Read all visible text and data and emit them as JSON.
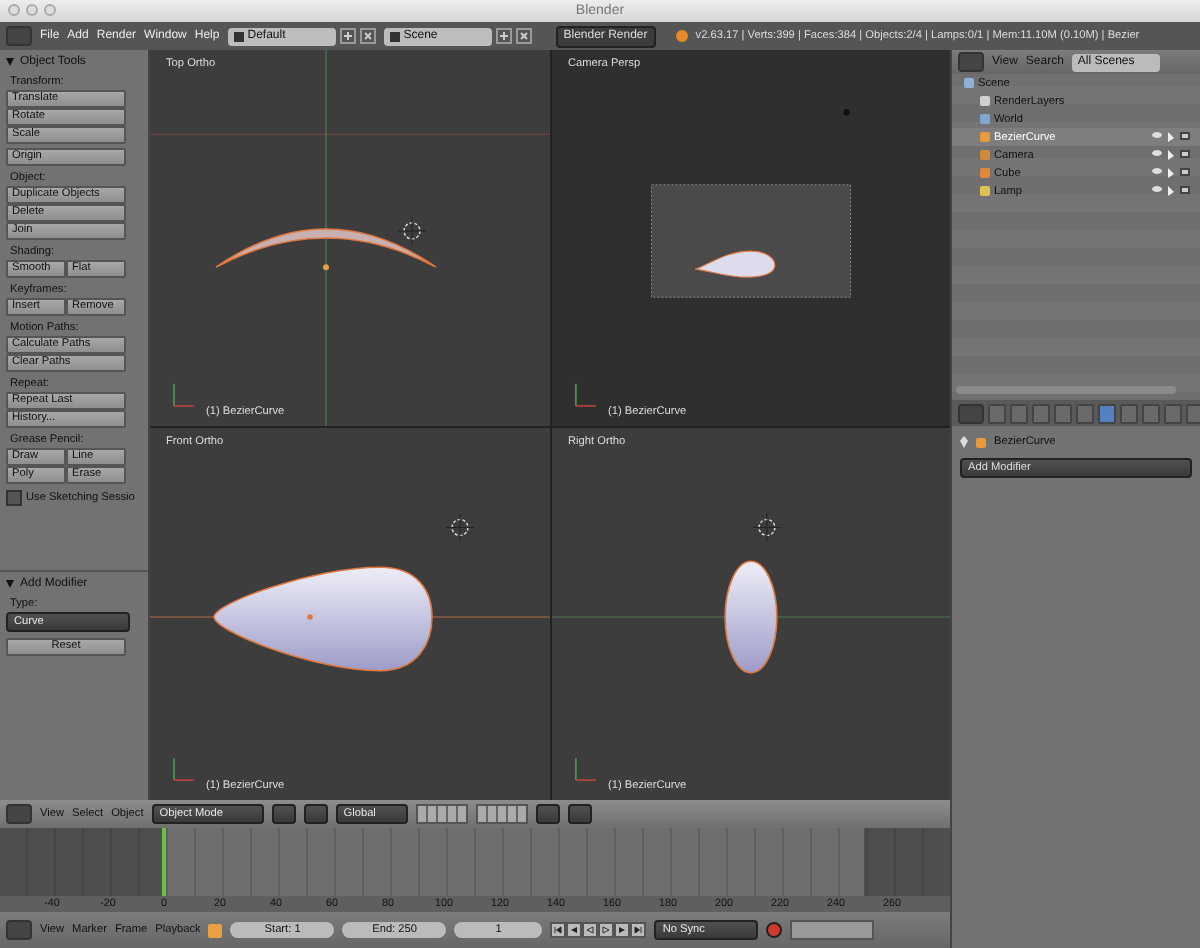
{
  "window": {
    "title": "Blender"
  },
  "info_header": {
    "menus": [
      "File",
      "Add",
      "Render",
      "Window",
      "Help"
    ],
    "layout": "Default",
    "scene": "Scene",
    "engine": "Blender Render",
    "stats": "v2.63.17 | Verts:399 | Faces:384 | Objects:2/4 | Lamps:0/1 | Mem:11.10M (0.10M) | Bezier"
  },
  "tool_panel": {
    "title": "Object Tools",
    "sections": [
      {
        "label": "Transform:",
        "kind": "stack",
        "buttons": [
          "Translate",
          "Rotate",
          "Scale"
        ]
      },
      {
        "kind": "stack",
        "buttons": [
          "Origin"
        ]
      },
      {
        "label": "Object:",
        "kind": "stack",
        "buttons": [
          "Duplicate Objects",
          "Delete",
          "Join"
        ]
      },
      {
        "label": "Shading:",
        "kind": "grid",
        "buttons": [
          "Smooth",
          "Flat"
        ]
      },
      {
        "label": "Keyframes:",
        "kind": "grid",
        "buttons": [
          "Insert",
          "Remove"
        ]
      },
      {
        "label": "Motion Paths:",
        "kind": "stack",
        "buttons": [
          "Calculate Paths",
          "Clear Paths"
        ]
      },
      {
        "label": "Repeat:",
        "kind": "stack",
        "buttons": [
          "Repeat Last",
          "History..."
        ]
      },
      {
        "label": "Grease Pencil:",
        "kind": "grid",
        "buttons": [
          "Draw",
          "Line",
          "Poly",
          "Erase"
        ]
      }
    ],
    "checkbox": {
      "label": "Use Sketching Sessio",
      "checked": false
    }
  },
  "operator_panel": {
    "title": "Add Modifier",
    "type_label": "Type:",
    "type_value": "Curve",
    "reset": "Reset"
  },
  "viewports": [
    {
      "kind": "top",
      "title": "Top Ortho",
      "object": "(1) BezierCurve"
    },
    {
      "kind": "camera",
      "title": "Camera Persp",
      "object": "(1) BezierCurve"
    },
    {
      "kind": "front",
      "title": "Front Ortho",
      "object": "(1) BezierCurve"
    },
    {
      "kind": "right",
      "title": "Right Ortho",
      "object": "(1) BezierCurve"
    }
  ],
  "outliner": {
    "menus": [
      "View",
      "Search"
    ],
    "filter": "All Scenes",
    "tree": [
      {
        "name": "Scene",
        "kind": "scene",
        "selected": false,
        "children": [
          {
            "name": "RenderLayers",
            "kind": "layers",
            "selected": false
          },
          {
            "name": "World",
            "kind": "world",
            "selected": false
          },
          {
            "name": "BezierCurve",
            "kind": "curve",
            "selected": true
          },
          {
            "name": "Camera",
            "kind": "camera",
            "selected": false
          },
          {
            "name": "Cube",
            "kind": "mesh",
            "selected": false
          },
          {
            "name": "Lamp",
            "kind": "lamp",
            "selected": false
          }
        ]
      }
    ]
  },
  "properties": {
    "tabs": [
      {
        "selected": false
      },
      {
        "selected": false
      },
      {
        "selected": false
      },
      {
        "selected": false
      },
      {
        "selected": false
      },
      {
        "selected": true
      },
      {
        "selected": false
      },
      {
        "selected": false
      },
      {
        "selected": false
      },
      {
        "selected": false
      }
    ],
    "object": "BezierCurve",
    "add_modifier": "Add Modifier"
  },
  "view3d_header": {
    "menus": [
      "View",
      "Select",
      "Object"
    ],
    "mode": "Object Mode",
    "orientation": "Global"
  },
  "timeline": {
    "ruler": [
      "-40",
      "-20",
      "0",
      "20",
      "40",
      "60",
      "80",
      "100",
      "120",
      "140",
      "160",
      "180",
      "200",
      "220",
      "240",
      "260"
    ]
  },
  "timeline_header": {
    "menus": [
      "View",
      "Marker",
      "Frame",
      "Playback"
    ],
    "start": "Start: 1",
    "end": "End: 250",
    "frame": "1",
    "sync": "No Sync"
  }
}
